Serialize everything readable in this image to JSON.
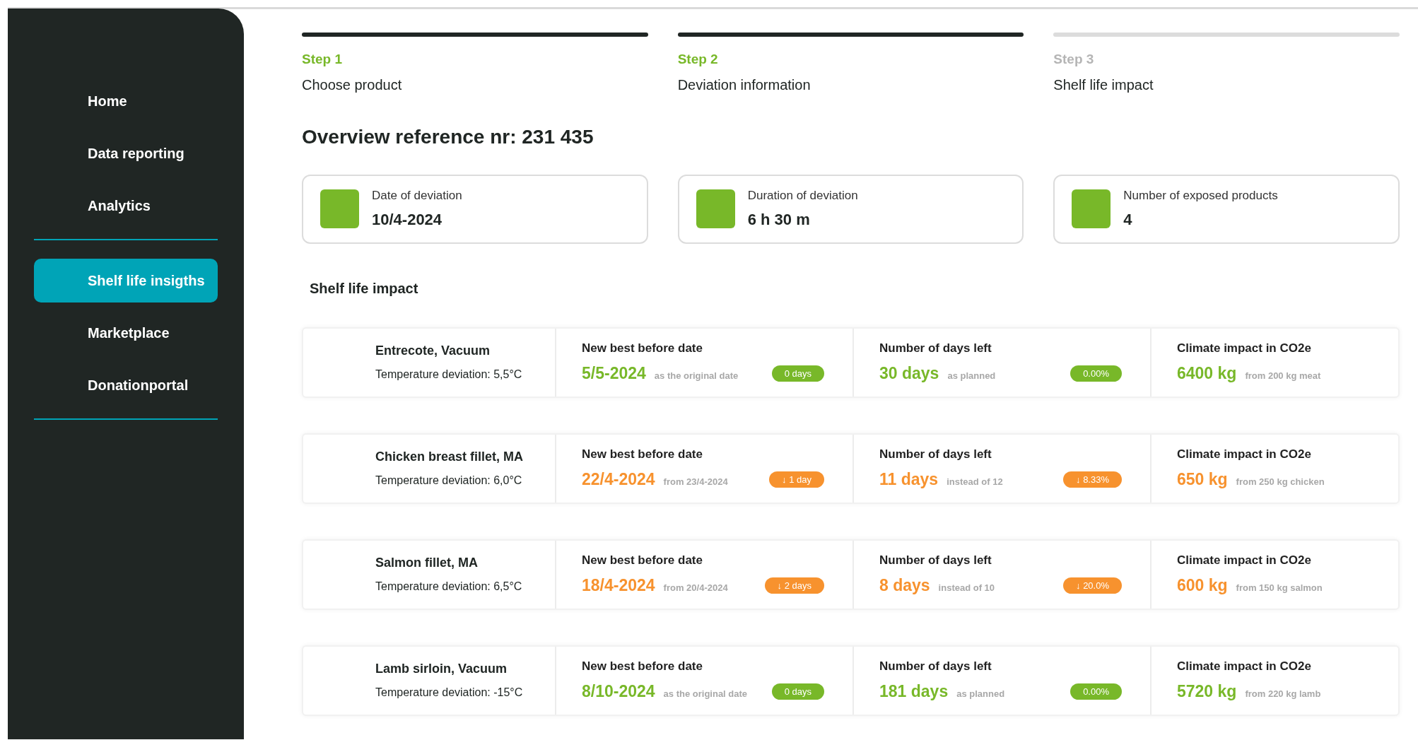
{
  "sidebar": {
    "groups": [
      [
        {
          "label": "Home",
          "selected": false
        },
        {
          "label": "Data reporting",
          "selected": false
        },
        {
          "label": "Analytics",
          "selected": false
        }
      ],
      [
        {
          "label": "Shelf life insigths",
          "selected": true
        },
        {
          "label": "Marketplace",
          "selected": false
        },
        {
          "label": "Donationportal",
          "selected": false
        }
      ]
    ]
  },
  "steps": [
    {
      "step": "Step 1",
      "title": "Choose product",
      "done": true
    },
    {
      "step": "Step 2",
      "title": "Deviation information",
      "done": true
    },
    {
      "step": "Step 3",
      "title": "Shelf life impact",
      "done": false
    }
  ],
  "heading": "Overview reference nr: 231 435",
  "summary_cards": [
    {
      "label": "Date of deviation",
      "value": "10/4-2024"
    },
    {
      "label": "Duration of deviation",
      "value": "6 h 30 m"
    },
    {
      "label": "Number of exposed products",
      "value": "4"
    }
  ],
  "section_title": "Shelf life impact",
  "products": [
    {
      "kind": "ok",
      "name": "Entrecote, Vacuum",
      "deviation": "Temperature deviation: 5,5°C",
      "date_label": "New best before date",
      "date": "5/5-2024",
      "date_note": "as the original date",
      "date_badge": "0 days",
      "days_label": "Number of days left",
      "days": "30 days",
      "days_note": "as planned",
      "days_badge": "0.00%",
      "climate_label": "Climate impact in CO2e",
      "climate": "6400 kg",
      "climate_note": "from 200 kg meat"
    },
    {
      "kind": "reduced",
      "name": "Chicken breast fillet, MA",
      "deviation": "Temperature deviation: 6,0°C",
      "date_label": "New best before date",
      "date": "22/4-2024",
      "date_note": "from 23/4-2024",
      "date_badge": "↓ 1 day",
      "days_label": "Number of days left",
      "days": "11 days",
      "days_note": "instead of 12",
      "days_badge": "↓ 8.33%",
      "climate_label": "Climate impact in CO2e",
      "climate": "650 kg",
      "climate_note": "from 250 kg chicken"
    },
    {
      "kind": "reduced",
      "name": "Salmon fillet, MA",
      "deviation": "Temperature deviation: 6,5°C",
      "date_label": "New best before date",
      "date": "18/4-2024",
      "date_note": "from 20/4-2024",
      "date_badge": "↓ 2 days",
      "days_label": "Number of days left",
      "days": "8 days",
      "days_note": "instead of 10",
      "days_badge": "↓ 20.0%",
      "climate_label": "Climate impact in CO2e",
      "climate": "600 kg",
      "climate_note": "from 150 kg salmon"
    },
    {
      "kind": "ok",
      "name": "Lamb sirloin, Vacuum",
      "deviation": "Temperature deviation: -15°C",
      "date_label": "New best before date",
      "date": "8/10-2024",
      "date_note": "as the original date",
      "date_badge": "0 days",
      "days_label": "Number of days left",
      "days": "181 days",
      "days_note": "as planned",
      "days_badge": "0.00%",
      "climate_label": "Climate impact in CO2e",
      "climate": "5720 kg",
      "climate_note": "from 220 kg lamb"
    }
  ]
}
